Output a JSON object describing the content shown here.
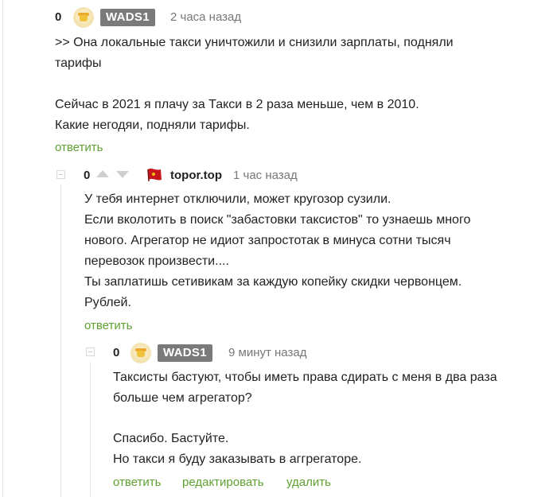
{
  "comment1": {
    "rating": "0",
    "username": "WADS1",
    "time": "2 часа назад",
    "lines": [
      ">> Она локальные такси уничтожили и снизили зарплаты, подняли",
      "тарифы",
      "",
      "Сейчас в 2021 я плачу за Такси в 2 раза меньше, чем в 2010.",
      "Какие негодяи, подняли тарифы."
    ],
    "reply_label": "ответить"
  },
  "comment2": {
    "rating": "0",
    "username": "topor.top",
    "time": "1 час назад",
    "lines": [
      "У тебя интернет отключили, может кругозор сузили.",
      "Если вколотить в поиск \"забастовки таксистов\" то узнаешь много",
      "нового. Агрегатор не идиот запростотак в минуса сотни тысяч",
      "перевозок произвести....",
      "Ты заплатишь сетивикам за каждую копейку скидки червонцем.",
      "Рублей."
    ],
    "reply_label": "ответить"
  },
  "comment3": {
    "rating": "0",
    "username": "WADS1",
    "time": "9 минут назад",
    "lines": [
      "Таксисты бастуют, чтобы иметь права сдирать с меня в два раза",
      "больше чем агрегатор?",
      "",
      "Спасибо. Бастуйте.",
      "Но такси я буду заказывать в аггрегаторе."
    ],
    "reply_label": "ответить",
    "edit_label": "редактировать",
    "delete_label": "удалить"
  },
  "colors": {
    "accent_green": "#5fa131",
    "badge_gray": "#7a7a7a",
    "meta_gray": "#777777"
  }
}
